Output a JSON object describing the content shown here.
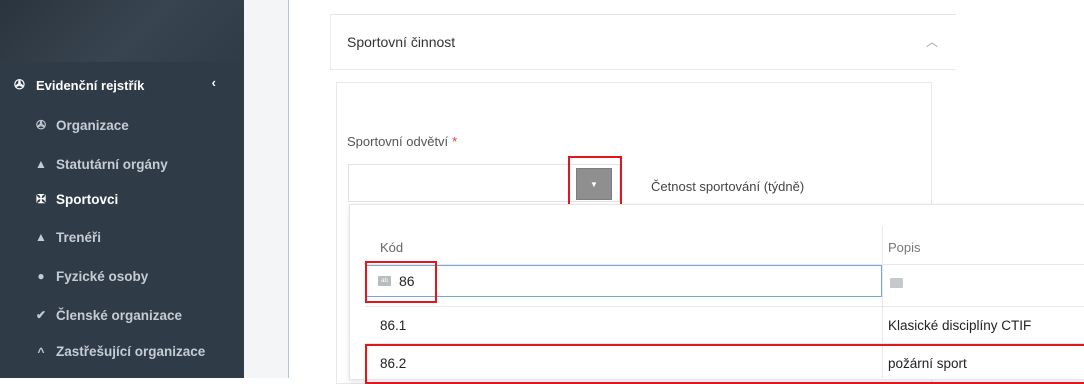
{
  "sidebar": {
    "section": {
      "label": "Evidenční rejstřík",
      "icon": "org-icon",
      "chevron": "‹"
    },
    "items": [
      {
        "label": "Organizace",
        "icon": "org-icon"
      },
      {
        "label": "Statutární orgány",
        "icon": "stamp-icon"
      },
      {
        "label": "Sportovci",
        "icon": "runner-icon",
        "active": true
      },
      {
        "label": "Trenéři",
        "icon": "user-icon"
      },
      {
        "label": "Fyzické osoby",
        "icon": "user-circle-icon"
      },
      {
        "label": "Členské organizace",
        "icon": "user-check-icon"
      },
      {
        "label": "Zastřešující organizace",
        "icon": "chevron-up-icon"
      }
    ]
  },
  "panel": {
    "title": "Sportovní činnost",
    "collapse_icon": "chevron-up-icon"
  },
  "form": {
    "sport_label": "Sportovní odvětví",
    "required_mark": "*",
    "frequency_label": "Četnost sportování (týdně)"
  },
  "grid": {
    "columns": [
      "Kód",
      "Popis"
    ],
    "filter": {
      "kod_value": "86",
      "popis_value": ""
    },
    "rows": [
      {
        "kod": "86.1",
        "popis": "Klasické disciplíny CTIF"
      },
      {
        "kod": "86.2",
        "popis": "požární sport"
      }
    ]
  },
  "colors": {
    "sidebar_bg": "#2f3b47",
    "highlight": "#e4161b",
    "filter_border": "#79a6d2",
    "required": "#e53935"
  }
}
